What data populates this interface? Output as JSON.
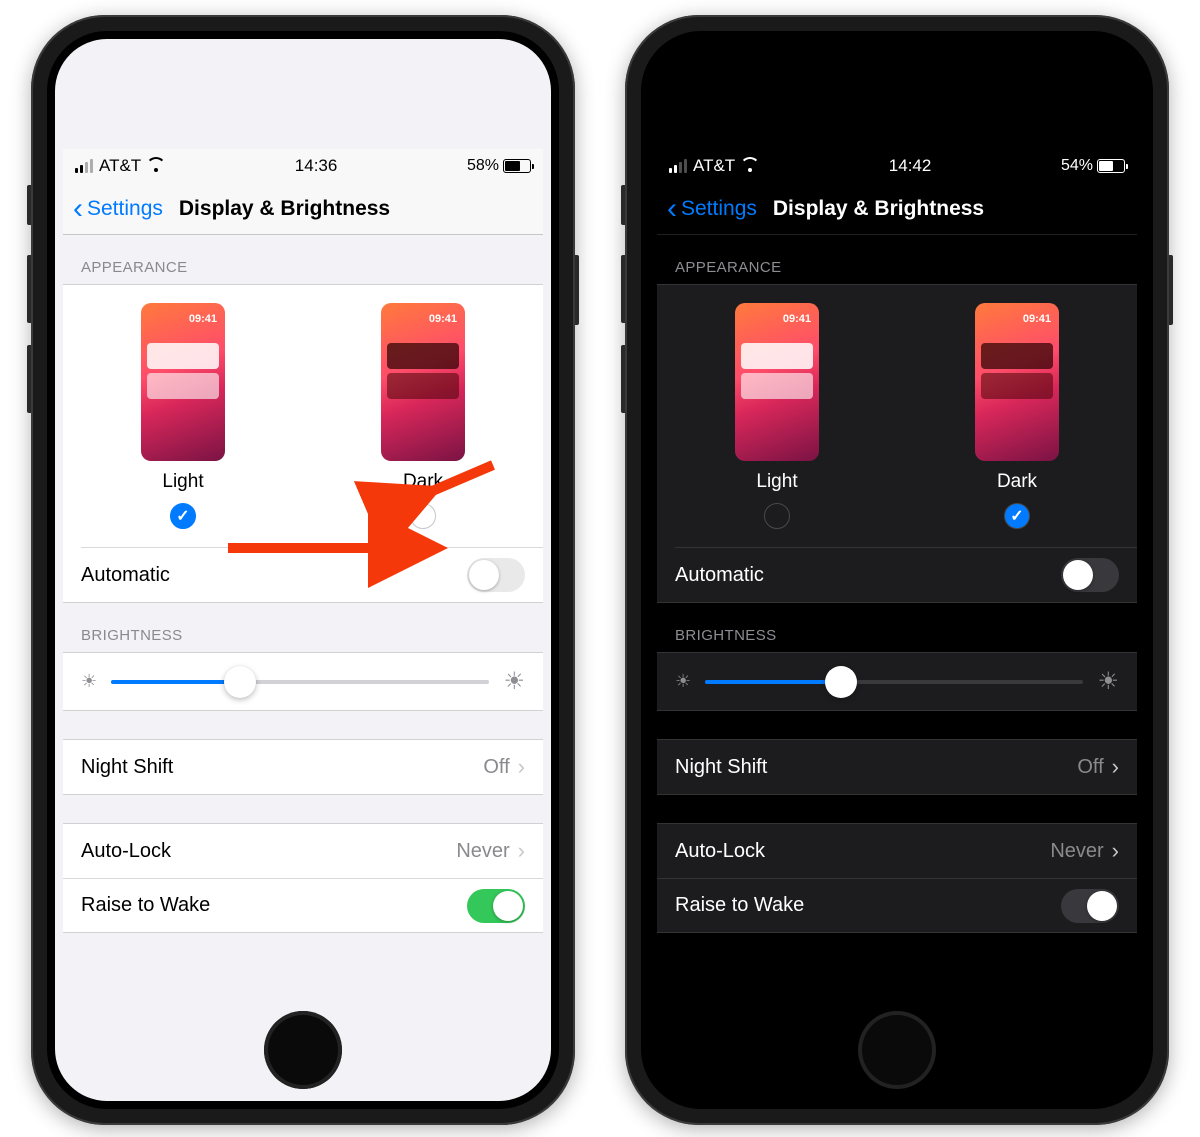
{
  "phones": {
    "light": {
      "theme": "light",
      "statusBar": {
        "carrier": "AT&T",
        "time": "14:36",
        "batteryPct": "58%",
        "batteryFill": 58
      },
      "nav": {
        "back": "Settings",
        "title": "Display & Brightness"
      },
      "appearance": {
        "header": "APPEARANCE",
        "options": {
          "light": {
            "label": "Light",
            "previewTime": "09:41",
            "checked": true
          },
          "dark": {
            "label": "Dark",
            "previewTime": "09:41",
            "checked": false
          }
        },
        "automatic": {
          "label": "Automatic",
          "on": false
        }
      },
      "brightness": {
        "header": "BRIGHTNESS",
        "value": 34
      },
      "nightShift": {
        "label": "Night Shift",
        "value": "Off"
      },
      "autoLock": {
        "label": "Auto-Lock",
        "value": "Never"
      },
      "raiseToWake": {
        "label": "Raise to Wake",
        "on": true
      },
      "annotations": {
        "showArrows": true
      }
    },
    "dark": {
      "theme": "dark",
      "statusBar": {
        "carrier": "AT&T",
        "time": "14:42",
        "batteryPct": "54%",
        "batteryFill": 54
      },
      "nav": {
        "back": "Settings",
        "title": "Display & Brightness"
      },
      "appearance": {
        "header": "APPEARANCE",
        "options": {
          "light": {
            "label": "Light",
            "previewTime": "09:41",
            "checked": false
          },
          "dark": {
            "label": "Dark",
            "previewTime": "09:41",
            "checked": true
          }
        },
        "automatic": {
          "label": "Automatic",
          "on": false
        }
      },
      "brightness": {
        "header": "BRIGHTNESS",
        "value": 36
      },
      "nightShift": {
        "label": "Night Shift",
        "value": "Off"
      },
      "autoLock": {
        "label": "Auto-Lock",
        "value": "Never"
      },
      "raiseToWake": {
        "label": "Raise to Wake",
        "on": true
      },
      "annotations": {
        "showArrows": false
      }
    }
  },
  "colors": {
    "iosBlue": "#007aff",
    "iosGreen": "#34c759",
    "arrowRed": "#f43809"
  }
}
